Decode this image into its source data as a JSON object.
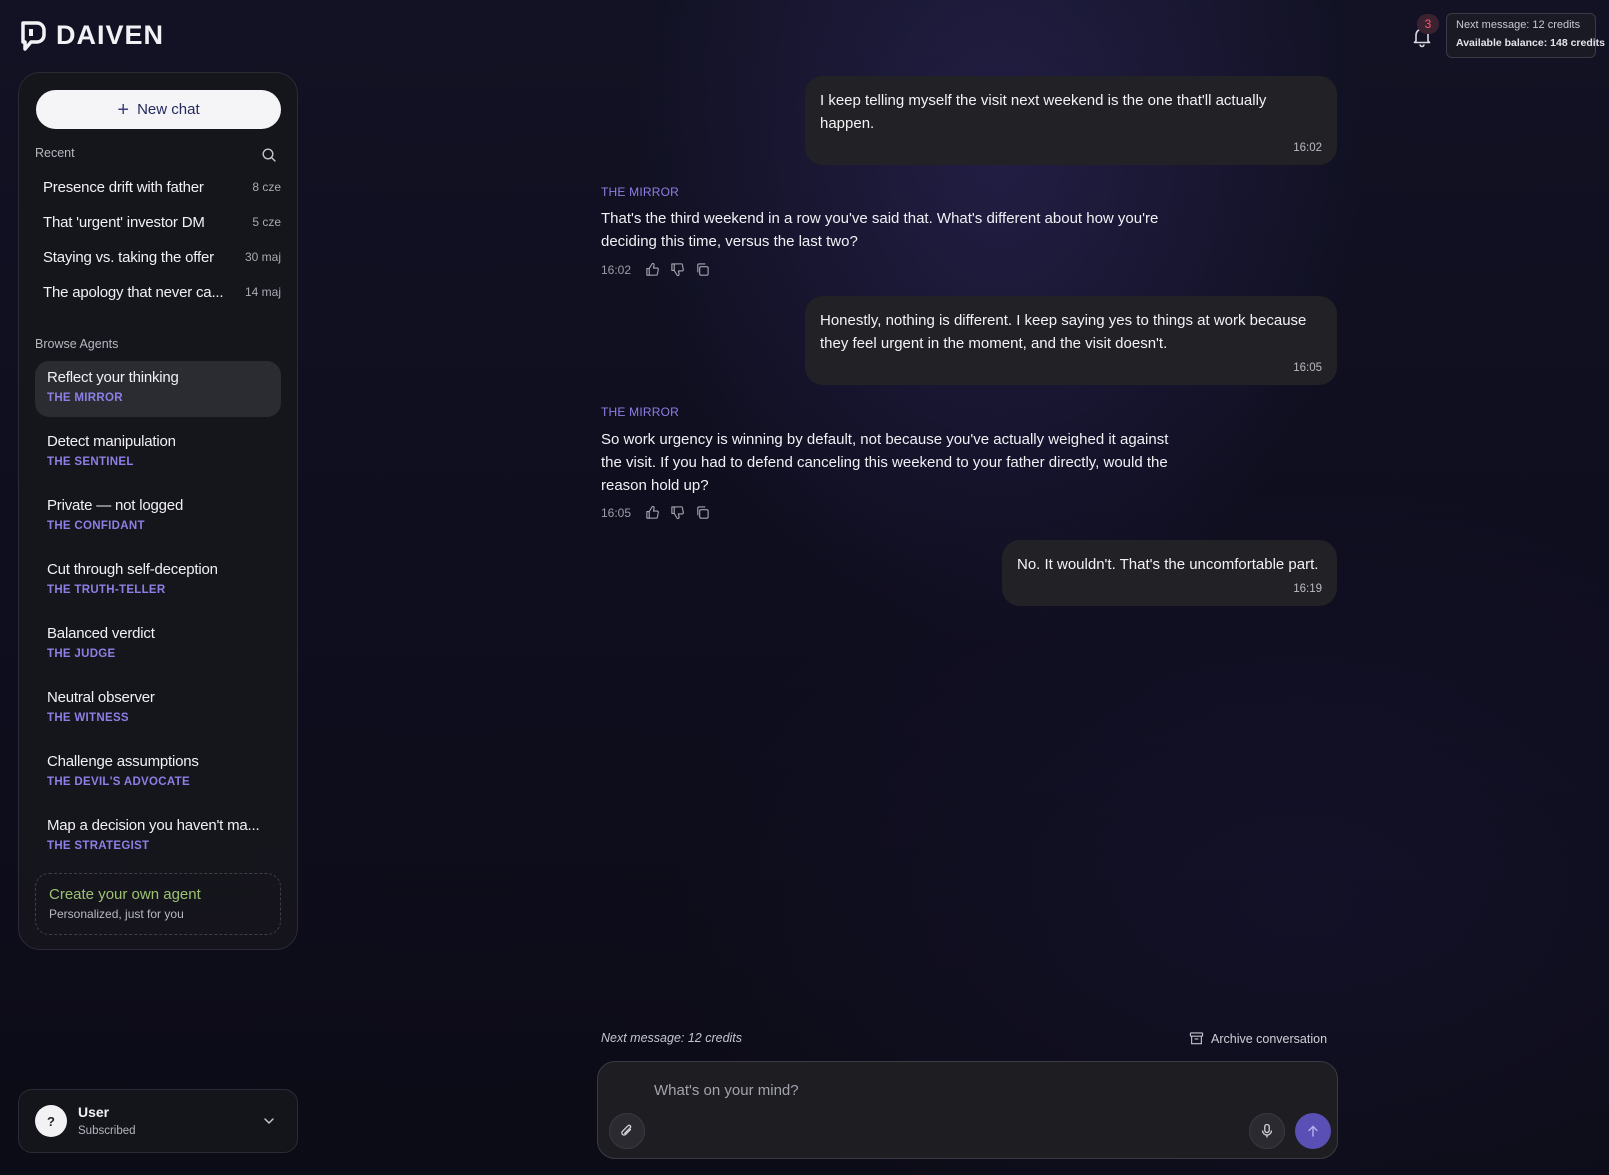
{
  "app": {
    "name": "DAIVEN"
  },
  "header": {
    "notifications_count": "3",
    "credits_next": "Next message: 12 credits",
    "credits_balance": "Available balance: 148 credits"
  },
  "sidebar": {
    "new_chat_label": "New chat",
    "recent_heading": "Recent",
    "recent": [
      {
        "title": "Presence drift with father",
        "date": "8 cze"
      },
      {
        "title": "That 'urgent' investor DM",
        "date": "5 cze"
      },
      {
        "title": "Staying vs. taking the offer",
        "date": "30 maj"
      },
      {
        "title": "The apology that never ca...",
        "date": "14 maj"
      }
    ],
    "agents_heading": "Browse Agents",
    "agents": [
      {
        "title": "Reflect your thinking",
        "name": "THE MIRROR"
      },
      {
        "title": "Detect manipulation",
        "name": "THE SENTINEL"
      },
      {
        "title": "Private — not logged",
        "name": "THE CONFIDANT"
      },
      {
        "title": "Cut through self-deception",
        "name": "THE TRUTH-TELLER"
      },
      {
        "title": "Balanced verdict",
        "name": "THE JUDGE"
      },
      {
        "title": "Neutral observer",
        "name": "THE WITNESS"
      },
      {
        "title": "Challenge assumptions",
        "name": "THE DEVIL'S ADVOCATE"
      },
      {
        "title": "Map a decision you haven't ma...",
        "name": "THE STRATEGIST"
      }
    ],
    "create_agent": {
      "title": "Create your own agent",
      "subtitle": "Personalized, just for you"
    }
  },
  "user": {
    "avatar": "?",
    "name": "User",
    "status": "Subscribed"
  },
  "chat": {
    "messages": [
      {
        "role": "user",
        "text": "I keep telling myself the visit next weekend is the one that'll actually happen.",
        "time": "16:02"
      },
      {
        "role": "agent",
        "agent": "THE MIRROR",
        "text": "That's the third weekend in a row you've said that. What's different about how you're deciding this time, versus the last two?",
        "time": "16:02"
      },
      {
        "role": "user",
        "text": "Honestly, nothing is different. I keep saying yes to things at work because they feel urgent in the moment, and the visit doesn't.",
        "time": "16:05"
      },
      {
        "role": "agent",
        "agent": "THE MIRROR",
        "text": "So work urgency is winning by default, not because you've actually weighed it against the visit. If you had to defend canceling this weekend to your father directly, would the reason hold up?",
        "time": "16:05"
      },
      {
        "role": "user",
        "text": "No. It wouldn't. That's the uncomfortable part.",
        "time": "16:19"
      }
    ]
  },
  "composer": {
    "next_message": "Next message: 12 credits",
    "archive_label": "Archive conversation",
    "placeholder": "What's on your mind?"
  },
  "colors": {
    "accent": "#8c7fe6",
    "send": "#5a4fb4",
    "create_agent": "#9cc270",
    "badge": "#ff5a6e"
  }
}
